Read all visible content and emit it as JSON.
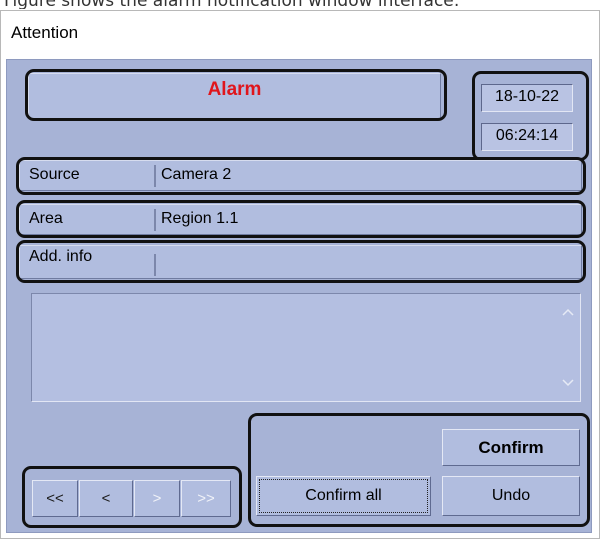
{
  "caption": "Figure shows the alarm notification window interface:",
  "window": {
    "title": "Attention"
  },
  "alarm": {
    "label": "Alarm",
    "date": "18-10-22",
    "time": "06:24:14"
  },
  "fields": [
    {
      "label": "Source",
      "value": "Camera 2"
    },
    {
      "label": "Area",
      "value": "Region 1.1"
    },
    {
      "label": "Add. info",
      "value": ""
    }
  ],
  "scrollbar": {
    "up_icon": "chevron-up-icon",
    "down_icon": "chevron-down-icon"
  },
  "navigation": {
    "first": "<<",
    "prev": "<",
    "next": ">",
    "last": ">>"
  },
  "buttons": {
    "confirm": "Confirm",
    "confirm_all": "Confirm all",
    "undo": "Undo"
  },
  "colors": {
    "panel": "#a7b3d6",
    "alarm_text": "#e0161c",
    "callout": "#111111"
  }
}
